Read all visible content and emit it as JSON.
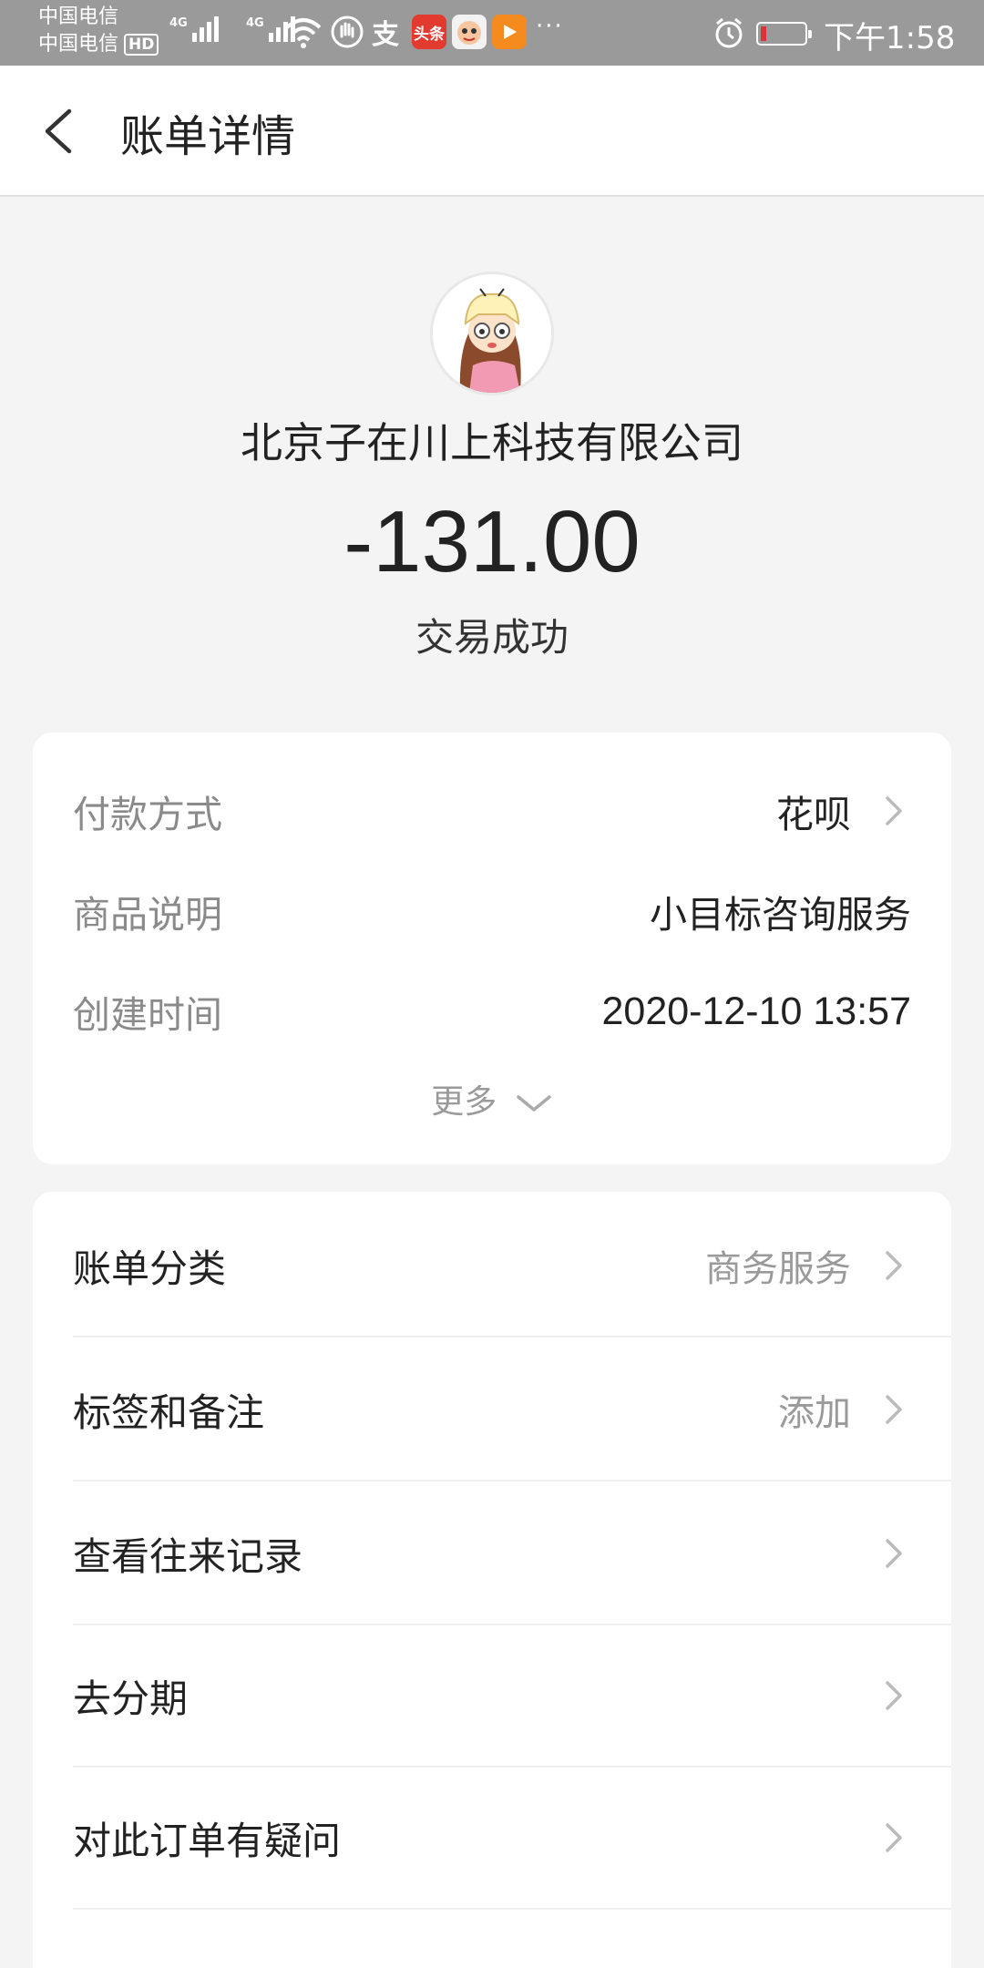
{
  "status_bar": {
    "carrier_1": "中国电信",
    "carrier_2": "中国电信",
    "hd": "HD",
    "network_1": "4G",
    "network_2": "4G",
    "app_badge_toutiao": "头条",
    "alipay_glyph": "支",
    "more": "···",
    "time": "下午1:58",
    "battery_color": "#e0303a"
  },
  "header": {
    "title": "账单详情"
  },
  "transaction": {
    "merchant": "北京子在川上科技有限公司",
    "amount": "-131.00",
    "status": "交易成功"
  },
  "details": {
    "rows": [
      {
        "label": "付款方式",
        "value": "花呗"
      },
      {
        "label": "商品说明",
        "value": "小目标咨询服务"
      },
      {
        "label": "创建时间",
        "value": "2020-12-10 13:57"
      }
    ],
    "more": "更多"
  },
  "actions": [
    {
      "label": "账单分类",
      "value": "商务服务"
    },
    {
      "label": "标签和备注",
      "value": "添加"
    },
    {
      "label": "查看往来记录",
      "value": ""
    },
    {
      "label": "去分期",
      "value": ""
    },
    {
      "label": "对此订单有疑问",
      "value": ""
    }
  ]
}
